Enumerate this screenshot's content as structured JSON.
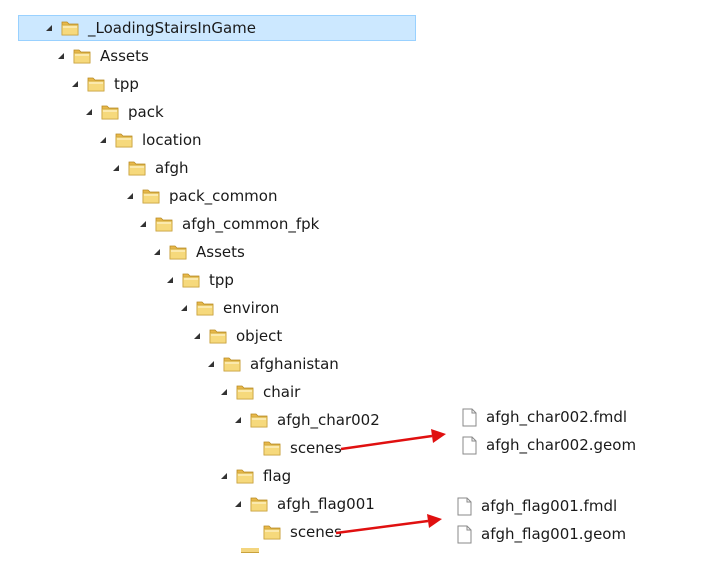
{
  "tree": [
    {
      "label": "_LoadingStairsInGame",
      "expanded": true,
      "selected": true
    },
    {
      "label": "Assets",
      "expanded": true
    },
    {
      "label": "tpp",
      "expanded": true
    },
    {
      "label": "pack",
      "expanded": true
    },
    {
      "label": "location",
      "expanded": true
    },
    {
      "label": "afgh",
      "expanded": true
    },
    {
      "label": "pack_common",
      "expanded": true
    },
    {
      "label": "afgh_common_fpk",
      "expanded": true
    },
    {
      "label": "Assets",
      "expanded": true
    },
    {
      "label": "tpp",
      "expanded": true
    },
    {
      "label": "environ",
      "expanded": true
    },
    {
      "label": "object",
      "expanded": true
    },
    {
      "label": "afghanistan",
      "expanded": true
    },
    {
      "label": "chair",
      "expanded": true
    },
    {
      "label": "afgh_char002",
      "expanded": true
    },
    {
      "label": "scenes",
      "expanded": false
    },
    {
      "label": "flag",
      "expanded": true
    },
    {
      "label": "afgh_flag001",
      "expanded": true
    },
    {
      "label": "scenes",
      "expanded": false
    }
  ],
  "file_groups": [
    {
      "files": [
        "afgh_char002.fmdl",
        "afgh_char002.geom"
      ]
    },
    {
      "files": [
        "afgh_flag001.fmdl",
        "afgh_flag001.geom"
      ]
    }
  ],
  "colors": {
    "arrow": "#e01010",
    "selection": "#cce8ff",
    "folder": "#f3d57e"
  }
}
